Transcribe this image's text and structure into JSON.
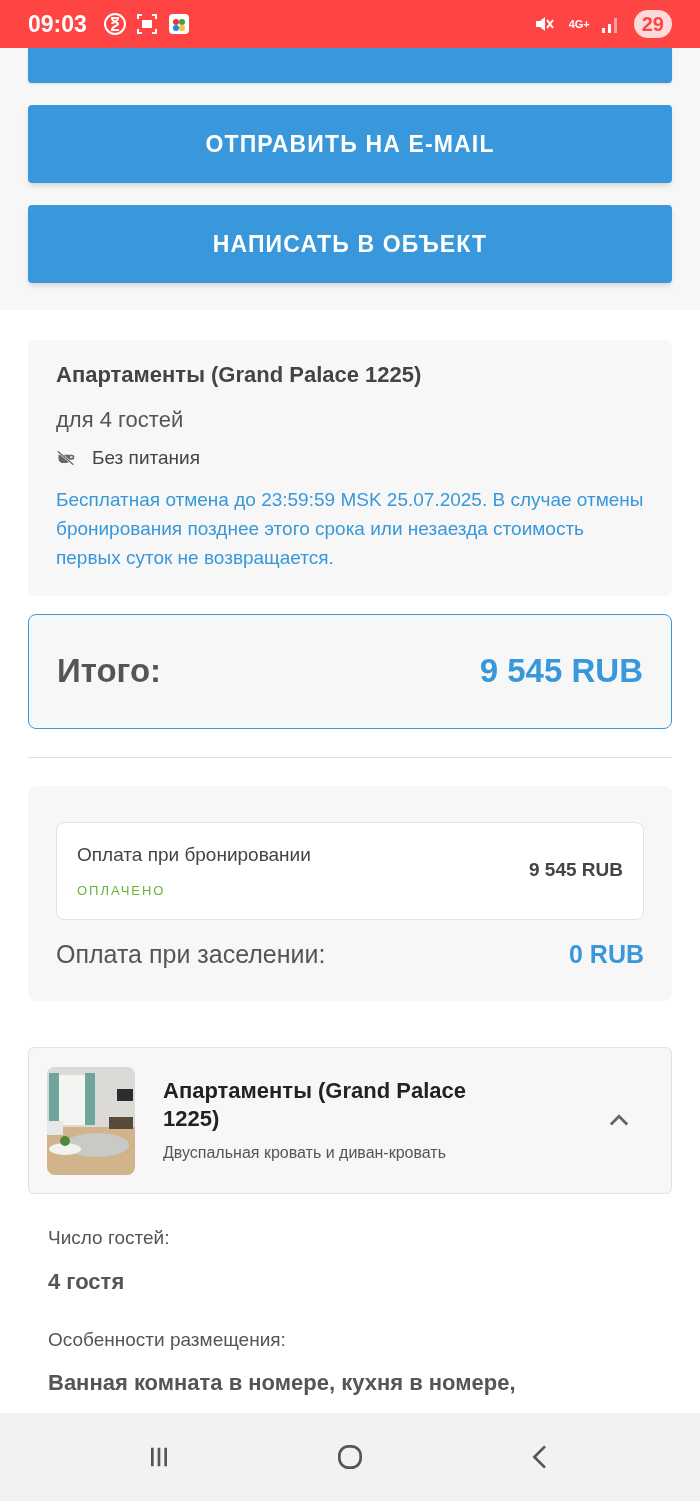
{
  "status_bar": {
    "time": "09:03",
    "network": "4G+",
    "battery": "29"
  },
  "actions": [
    {
      "label": "ОТПРАВИТЬ НА E-MAIL"
    },
    {
      "label": "НАПИСАТЬ В ОБЪЕКТ"
    }
  ],
  "offer": {
    "title": "Апартаменты (Grand Palace 1225)",
    "guests": "для 4 гостей",
    "meal": "Без питания",
    "cancellation": "Бесплатная отмена до 23:59:59 MSK 25.07.2025. В случае отмены бронирования позднее этого срока или незаезда стоимость первых суток не возвращается."
  },
  "total": {
    "label": "Итого:",
    "amount": "9 545 RUB"
  },
  "payments": {
    "booking": {
      "label": "Оплата при бронировании",
      "status": "ОПЛАЧЕНО",
      "amount": "9 545 RUB"
    },
    "checkin": {
      "label": "Оплата при заселении:",
      "amount": "0 RUB"
    }
  },
  "room": {
    "title": "Апартаменты (Grand Palace 1225)",
    "beds": "Двуспальная кровать и диван-кровать",
    "expanded": true
  },
  "details": [
    {
      "label": "Число гостей:",
      "value": "4 гостя"
    },
    {
      "label": "Особенности размещения:",
      "value": "Ванная комната в номере, кухня в номере,"
    }
  ]
}
